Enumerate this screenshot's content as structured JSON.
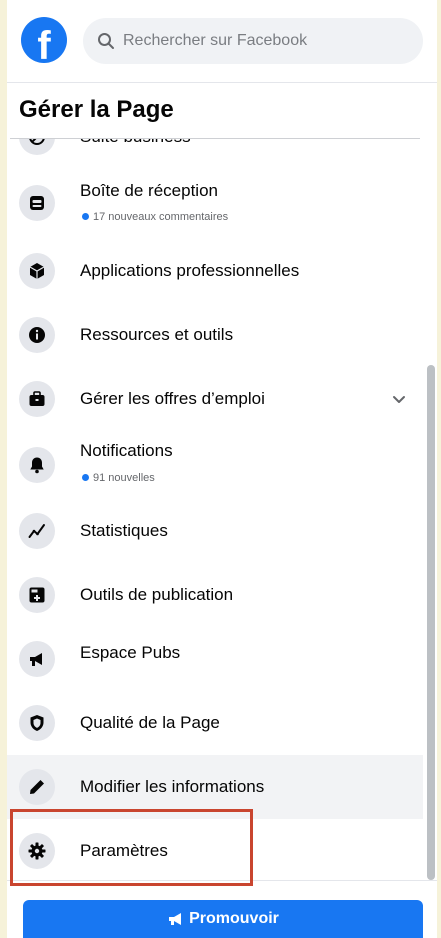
{
  "header": {
    "logo_letter": "f",
    "search_placeholder": "Rechercher sur Facebook"
  },
  "page_title": "Gérer la Page",
  "menu": [
    {
      "id": "suite-business",
      "label": "Suite business",
      "icon": "suite-business-icon"
    },
    {
      "id": "inbox",
      "label": "Boîte de réception",
      "sub": "17 nouveaux commentaires",
      "icon": "inbox-icon"
    },
    {
      "id": "business-apps",
      "label": "Applications professionnelles",
      "icon": "cube-icon"
    },
    {
      "id": "resources",
      "label": "Ressources et outils",
      "icon": "info-icon"
    },
    {
      "id": "jobs",
      "label": "Gérer les offres d’emploi",
      "icon": "briefcase-icon",
      "expandable": true
    },
    {
      "id": "notifications",
      "label": "Notifications",
      "sub": "91 nouvelles",
      "icon": "bell-icon"
    },
    {
      "id": "insights",
      "label": "Statistiques",
      "icon": "chart-line-icon"
    },
    {
      "id": "publishing-tools",
      "label": "Outils de publication",
      "icon": "publishing-icon"
    },
    {
      "id": "ad-center",
      "label": "Espace Pubs",
      "icon": "megaphone-icon"
    },
    {
      "id": "page-quality",
      "label": "Qualité de la Page",
      "icon": "shield-icon"
    },
    {
      "id": "edit-info",
      "label": "Modifier les informations",
      "icon": "pencil-icon"
    },
    {
      "id": "settings",
      "label": "Paramètres",
      "icon": "gear-icon"
    }
  ],
  "promote_button": "Promouvoir",
  "colors": {
    "brand_blue": "#1877f2",
    "highlight_red": "#c9452f",
    "background": "#f6f2d9"
  }
}
